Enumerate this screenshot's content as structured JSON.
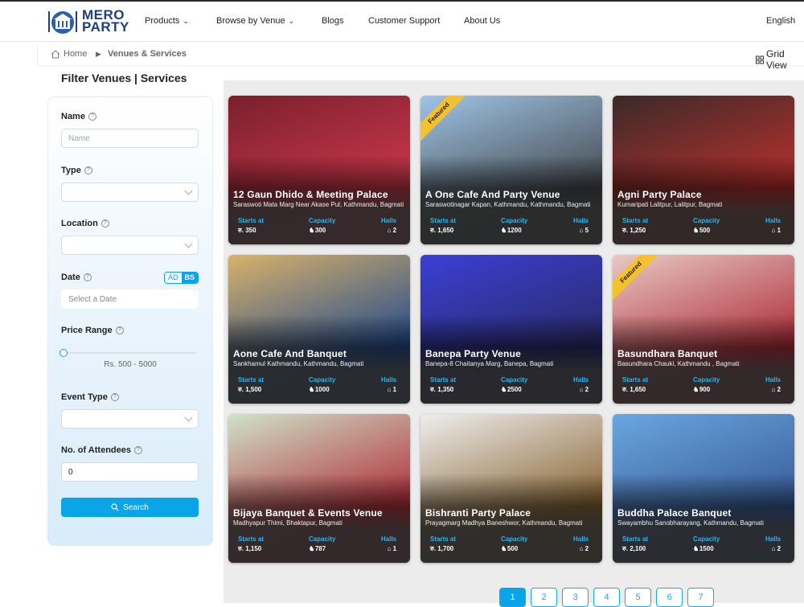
{
  "header": {
    "logo_line1": "MERO",
    "logo_line2": "PARTY",
    "nav": [
      "Products",
      "Browse by Venue",
      "Blogs",
      "Customer Support",
      "About Us"
    ],
    "language": "English"
  },
  "breadcrumb": {
    "home": "Home",
    "current": "Venues & Services",
    "grid_view": "Grid View"
  },
  "filters": {
    "title": "Filter Venues | Services",
    "name_label": "Name",
    "name_placeholder": "Name",
    "type_label": "Type",
    "location_label": "Location",
    "date_label": "Date",
    "date_ad": "AD",
    "date_bs": "BS",
    "date_placeholder": "Select a Date",
    "price_label": "Price Range",
    "price_text": "Rs. 500 - 5000",
    "event_type_label": "Event Type",
    "attendees_label": "No. of Attendees",
    "attendees_value": "0",
    "search_label": "Search"
  },
  "labels": {
    "starts_at": "Starts at",
    "capacity": "Capacity",
    "halls": "Halls"
  },
  "venues": [
    {
      "name": "12 Gaun Dhido & Meeting Palace",
      "address": "Saraswoti Mata Marg Near Akase Pul, Kathmandu, Bagmati",
      "price": "रु. 350",
      "capacity": "300",
      "halls": "2",
      "featured": false,
      "c1": "#7a1f2d",
      "c2": "#c8374a"
    },
    {
      "name": "A One Cafe And Party Venue",
      "address": "Saraswotinagar Kapan, Kathmandu, Kathmandu, Bagmati",
      "price": "रु. 1,650",
      "capacity": "1200",
      "halls": "5",
      "featured": true,
      "featured_label": "Featured",
      "c1": "#9ec4e6",
      "c2": "#4a4f55"
    },
    {
      "name": "Agni Party Palace",
      "address": "Kumaripati Lalitpur, Lalitpur, Bagmati",
      "price": "रु. 1,250",
      "capacity": "500",
      "halls": "1",
      "featured": false,
      "c1": "#3a2a2a",
      "c2": "#b5302c"
    },
    {
      "name": "Aone Cafe And Banquet",
      "address": "Sankhamul Kathmandu, Kathmandu, Bagmati",
      "price": "रु. 1,500",
      "capacity": "1000",
      "halls": "1",
      "featured": false,
      "c1": "#d9b26a",
      "c2": "#2a4f8a"
    },
    {
      "name": "Banepa Party Venue",
      "address": "Banepa-8 Chaitanya Marg, Banepa, Bagmati",
      "price": "रु. 1,350",
      "capacity": "2500",
      "halls": "2",
      "featured": false,
      "c1": "#3b3fd6",
      "c2": "#2a2b6b"
    },
    {
      "name": "Basundhara Banquet",
      "address": "Basundhara Chauki, Kathmandu , Bagmati",
      "price": "रु. 1,650",
      "capacity": "900",
      "halls": "2",
      "featured": true,
      "featured_label": "Featured",
      "c1": "#e8c9c4",
      "c2": "#b0323e"
    },
    {
      "name": "Bijaya Banquet & Events Venue",
      "address": "Madhyapur Thimi, Bhaktapur, Bagmati",
      "price": "रु. 1,150",
      "capacity": "787",
      "halls": "1",
      "featured": false,
      "c1": "#cfe3c8",
      "c2": "#b2343f"
    },
    {
      "name": "Bishranti Party Palace",
      "address": "Prayagmarg Madhya Baneshwor, Kathmandu, Bagmati",
      "price": "रु. 1,700",
      "capacity": "500",
      "halls": "2",
      "featured": false,
      "c1": "#eeeeee",
      "c2": "#8d6a3a"
    },
    {
      "name": "Buddha Palace Banquet",
      "address": "Swayambhu Sanobharayang, Kathmandu, Bagmati",
      "price": "रु. 2,100",
      "capacity": "1500",
      "halls": "2",
      "featured": false,
      "c1": "#6aa7df",
      "c2": "#3a5f9b"
    }
  ],
  "pagination": [
    "1",
    "2",
    "3",
    "4",
    "5",
    "6",
    "7"
  ]
}
